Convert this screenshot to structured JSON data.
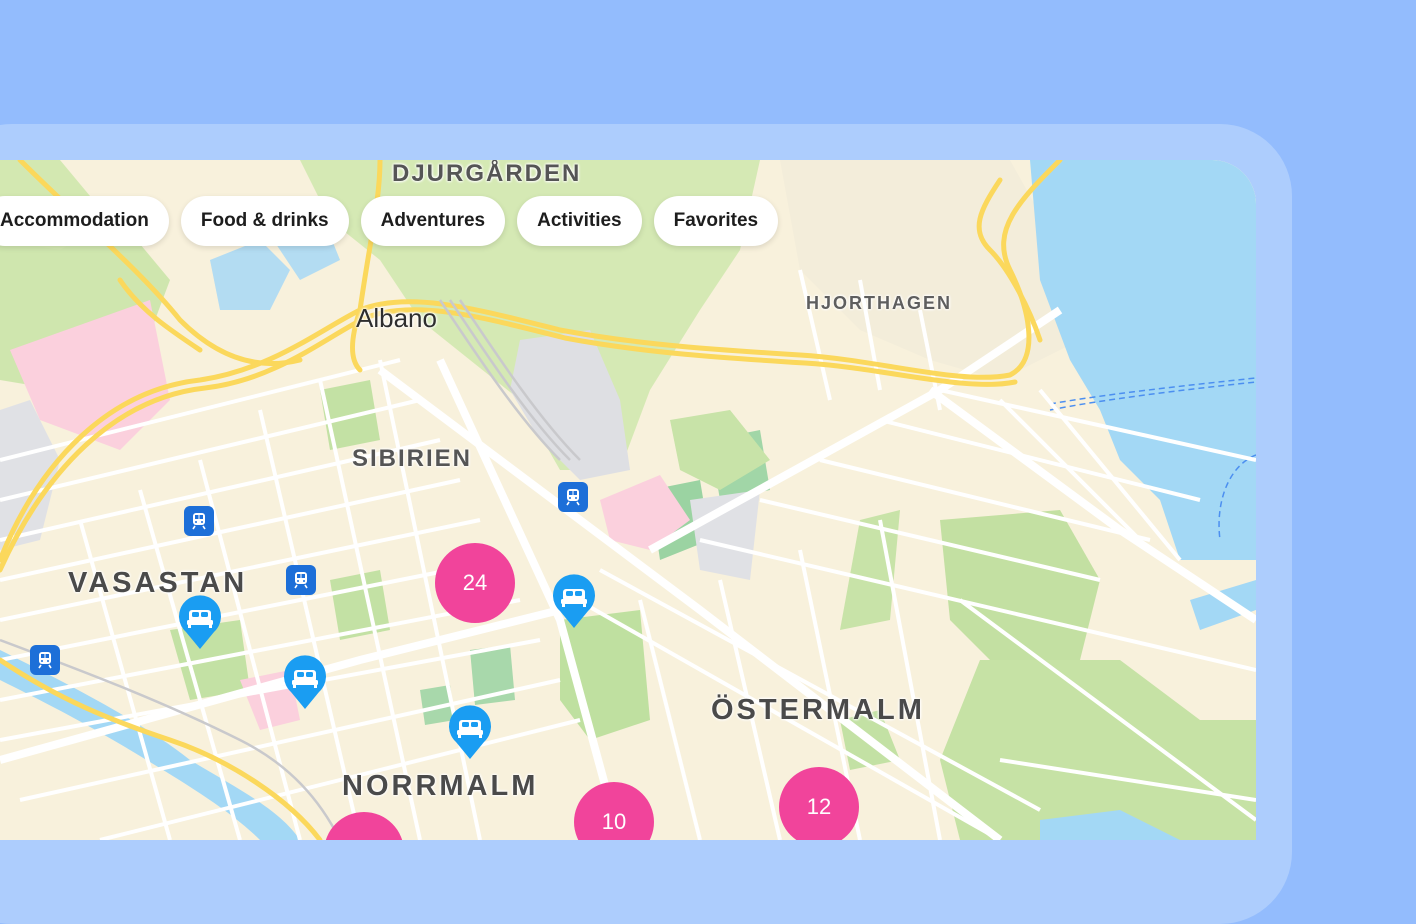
{
  "filters": [
    {
      "label": "Accommodation"
    },
    {
      "label": "Food & drinks"
    },
    {
      "label": "Adventures"
    },
    {
      "label": "Activities"
    },
    {
      "label": "Favorites"
    }
  ],
  "districts": {
    "djurgarden": "DJURGÅRDEN",
    "hjorthagen": "HJORTHAGEN",
    "sibirien": "SIBIRIEN",
    "vasastan": "VASASTAN",
    "ostermalm": "ÖSTERMALM",
    "norrmalm": "NORRMALM"
  },
  "places": {
    "albano": "Albano"
  },
  "clusters": [
    {
      "count": "24"
    },
    {
      "count": "10"
    },
    {
      "count": "12"
    },
    {
      "count": ""
    }
  ],
  "colors": {
    "background": "#93bcfd",
    "frame": "#adcdfd",
    "land": "#f8f1dc",
    "park": "#c7e3a6",
    "water": "#a3d8f5",
    "road_major": "#fbd85c",
    "cluster": "#f1449b",
    "hotel_pin": "#1a9df2",
    "transit": "#1d6fd8"
  },
  "icons": {
    "transit": "train-icon",
    "hotel": "bed-icon"
  }
}
